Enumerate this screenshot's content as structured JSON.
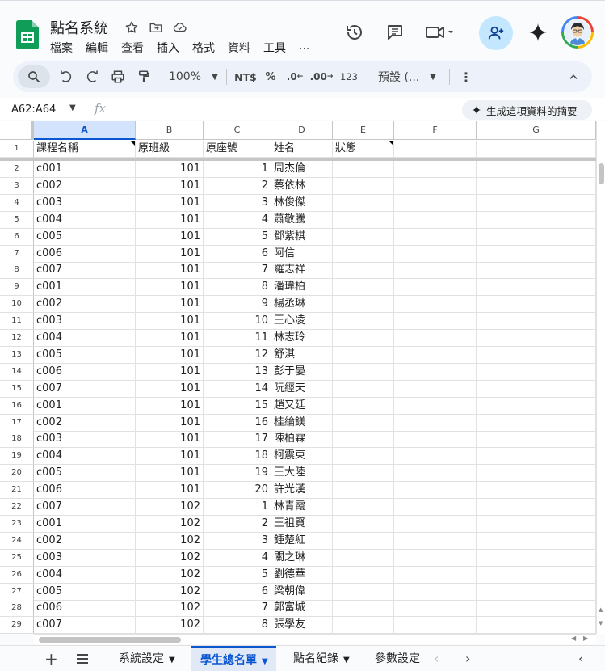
{
  "app": {
    "title": "點名系統",
    "menu": [
      "檔案",
      "編輯",
      "查看",
      "插入",
      "格式",
      "資料",
      "工具",
      "..."
    ]
  },
  "toolbar": {
    "zoom": "100%",
    "currency": "NT$",
    "percent": "%",
    "dec_decrease": ".0",
    "dec_increase": ".00",
    "number_format": "123",
    "font": "預設 (..."
  },
  "formula_bar": {
    "name_box": "A62:A64",
    "fx": "fx",
    "ai_button": "生成這項資料的摘要"
  },
  "columns": [
    "A",
    "B",
    "C",
    "D",
    "E",
    "F",
    "G"
  ],
  "header_row": {
    "row_number": "1",
    "values": [
      "課程名稱",
      "原班級",
      "原座號",
      "姓名",
      "狀態",
      "",
      ""
    ]
  },
  "rows": [
    {
      "n": "2",
      "course": "c001",
      "class": "101",
      "seat": "1",
      "name": "周杰倫"
    },
    {
      "n": "3",
      "course": "c002",
      "class": "101",
      "seat": "2",
      "name": "蔡依林"
    },
    {
      "n": "4",
      "course": "c003",
      "class": "101",
      "seat": "3",
      "name": "林俊傑"
    },
    {
      "n": "5",
      "course": "c004",
      "class": "101",
      "seat": "4",
      "name": "蕭敬騰"
    },
    {
      "n": "6",
      "course": "c005",
      "class": "101",
      "seat": "5",
      "name": "鄧紫棋"
    },
    {
      "n": "7",
      "course": "c006",
      "class": "101",
      "seat": "6",
      "name": "阿信"
    },
    {
      "n": "8",
      "course": "c007",
      "class": "101",
      "seat": "7",
      "name": "羅志祥"
    },
    {
      "n": "9",
      "course": "c001",
      "class": "101",
      "seat": "8",
      "name": "潘瑋柏"
    },
    {
      "n": "10",
      "course": "c002",
      "class": "101",
      "seat": "9",
      "name": "楊丞琳"
    },
    {
      "n": "11",
      "course": "c003",
      "class": "101",
      "seat": "10",
      "name": "王心凌"
    },
    {
      "n": "12",
      "course": "c004",
      "class": "101",
      "seat": "11",
      "name": "林志玲"
    },
    {
      "n": "13",
      "course": "c005",
      "class": "101",
      "seat": "12",
      "name": "舒淇"
    },
    {
      "n": "14",
      "course": "c006",
      "class": "101",
      "seat": "13",
      "name": "彭于晏"
    },
    {
      "n": "15",
      "course": "c007",
      "class": "101",
      "seat": "14",
      "name": "阮經天"
    },
    {
      "n": "16",
      "course": "c001",
      "class": "101",
      "seat": "15",
      "name": "趙又廷"
    },
    {
      "n": "17",
      "course": "c002",
      "class": "101",
      "seat": "16",
      "name": "桂綸鎂"
    },
    {
      "n": "18",
      "course": "c003",
      "class": "101",
      "seat": "17",
      "name": "陳柏霖"
    },
    {
      "n": "19",
      "course": "c004",
      "class": "101",
      "seat": "18",
      "name": "柯震東"
    },
    {
      "n": "20",
      "course": "c005",
      "class": "101",
      "seat": "19",
      "name": "王大陸"
    },
    {
      "n": "21",
      "course": "c006",
      "class": "101",
      "seat": "20",
      "name": "許光漢"
    },
    {
      "n": "22",
      "course": "c007",
      "class": "102",
      "seat": "1",
      "name": "林青霞"
    },
    {
      "n": "23",
      "course": "c001",
      "class": "102",
      "seat": "2",
      "name": "王祖賢"
    },
    {
      "n": "24",
      "course": "c002",
      "class": "102",
      "seat": "3",
      "name": "鍾楚紅"
    },
    {
      "n": "25",
      "course": "c003",
      "class": "102",
      "seat": "4",
      "name": "關之琳"
    },
    {
      "n": "26",
      "course": "c004",
      "class": "102",
      "seat": "5",
      "name": "劉德華"
    },
    {
      "n": "27",
      "course": "c005",
      "class": "102",
      "seat": "6",
      "name": "梁朝偉"
    },
    {
      "n": "28",
      "course": "c006",
      "class": "102",
      "seat": "7",
      "name": "郭富城"
    },
    {
      "n": "29",
      "course": "c007",
      "class": "102",
      "seat": "8",
      "name": "張學友"
    }
  ],
  "sheet_tabs": [
    "系統設定",
    "學生總名單",
    "點名紀錄",
    "參數設定"
  ],
  "active_tab": "學生總名單",
  "colors": {
    "accent": "#0b57d0",
    "selected_header": "#d3e3fd",
    "share_button": "#c2e7ff",
    "toolbar_bg": "#edf2fa",
    "sheets_green": "#0f9d58"
  }
}
